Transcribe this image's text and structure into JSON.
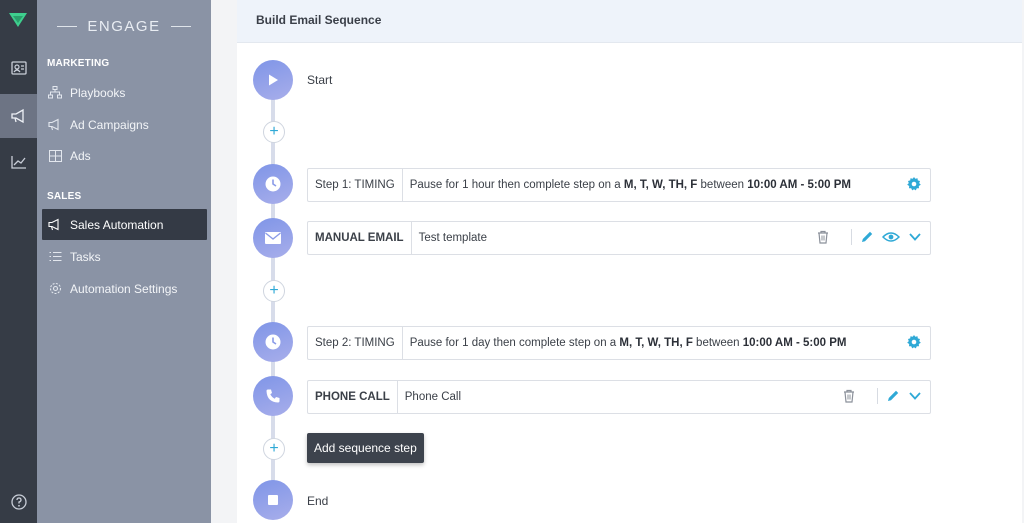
{
  "brand": {
    "name": "ENGAGE"
  },
  "rail": {
    "icons": [
      "logo-icon",
      "contact-card-icon",
      "megaphone-icon",
      "chart-icon",
      "help-icon"
    ]
  },
  "sidebar": {
    "sections": [
      {
        "title": "MARKETING",
        "items": [
          {
            "label": "Playbooks",
            "icon": "playbook-icon"
          },
          {
            "label": "Ad Campaigns",
            "icon": "megaphone-icon"
          },
          {
            "label": "Ads",
            "icon": "grid-icon"
          }
        ]
      },
      {
        "title": "SALES",
        "items": [
          {
            "label": "Sales Automation",
            "icon": "megaphone-icon",
            "active": true
          },
          {
            "label": "Tasks",
            "icon": "list-icon"
          },
          {
            "label": "Automation Settings",
            "icon": "gear-icon"
          }
        ]
      }
    ]
  },
  "page": {
    "title": "Build Email Sequence"
  },
  "sequence": {
    "start_label": "Start",
    "end_label": "End",
    "steps": [
      {
        "key": "Step 1: TIMING",
        "text_prefix": "Pause for 1 hour then complete step on a ",
        "days": "M, T, W, TH, F",
        "mid": " between ",
        "hours": "10:00 AM - 5:00 PM"
      },
      {
        "key": "MANUAL EMAIL",
        "value": "Test template"
      },
      {
        "key": "Step 2: TIMING",
        "text_prefix": "Pause for 1 day then complete step on a ",
        "days": "M, T, W, TH, F",
        "mid": " between ",
        "hours": "10:00 AM - 5:00 PM"
      },
      {
        "key": "PHONE CALL",
        "value": "Phone Call"
      }
    ],
    "tooltip": "Add sequence step"
  },
  "colors": {
    "accent": "#2fa9d6",
    "node": "#8a9be8",
    "sidebar": "#8a93a5",
    "rail": "#363c46"
  }
}
